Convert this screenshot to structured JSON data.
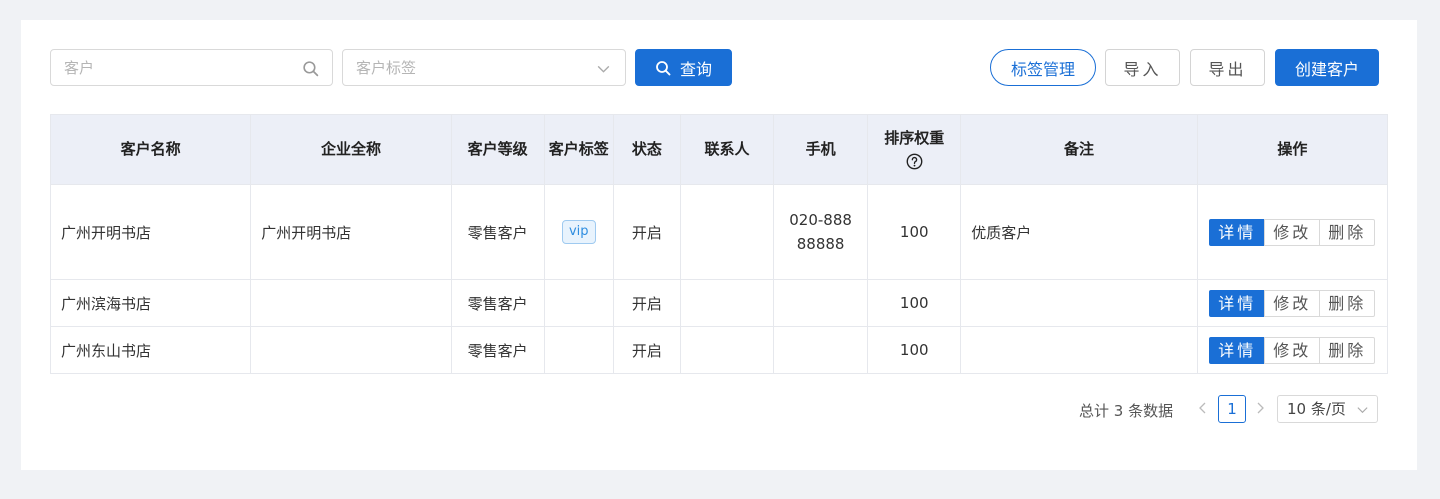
{
  "toolbar": {
    "customer_placeholder": "客户",
    "tag_placeholder": "客户标签",
    "query_label": "查询",
    "tag_manage_label": "标签管理",
    "import_label": "导入",
    "export_label": "导出",
    "create_label": "创建客户"
  },
  "table": {
    "headers": {
      "name": "客户名称",
      "company": "企业全称",
      "level": "客户等级",
      "tag": "客户标签",
      "status": "状态",
      "contact": "联系人",
      "phone": "手机",
      "weight": "排序权重",
      "remark": "备注",
      "ops": "操作"
    },
    "rows": [
      {
        "name": "广州开明书店",
        "company": "广州开明书店",
        "level": "零售客户",
        "tag": "vip",
        "status": "开启",
        "contact": "",
        "phone": "020-88888888",
        "weight": "100",
        "remark": "优质客户"
      },
      {
        "name": "广州滨海书店",
        "company": "",
        "level": "零售客户",
        "tag": "",
        "status": "开启",
        "contact": "",
        "phone": "",
        "weight": "100",
        "remark": ""
      },
      {
        "name": "广州东山书店",
        "company": "",
        "level": "零售客户",
        "tag": "",
        "status": "开启",
        "contact": "",
        "phone": "",
        "weight": "100",
        "remark": ""
      }
    ],
    "actions": {
      "detail": "详情",
      "edit": "修改",
      "delete": "删除"
    }
  },
  "pagination": {
    "total_text": "总计 3 条数据",
    "current_page": "1",
    "page_size": "10 条/页"
  },
  "icons": {
    "search": "search-icon",
    "dropdown": "chevron-down-icon",
    "help": "help-circle-icon",
    "prev": "chevron-left-icon",
    "next": "chevron-right-icon"
  },
  "colors": {
    "primary": "#1a6fd6",
    "header_bg": "#eceff7",
    "tag_bg": "#e8f3fd",
    "page_bg": "#f0f2f5"
  }
}
